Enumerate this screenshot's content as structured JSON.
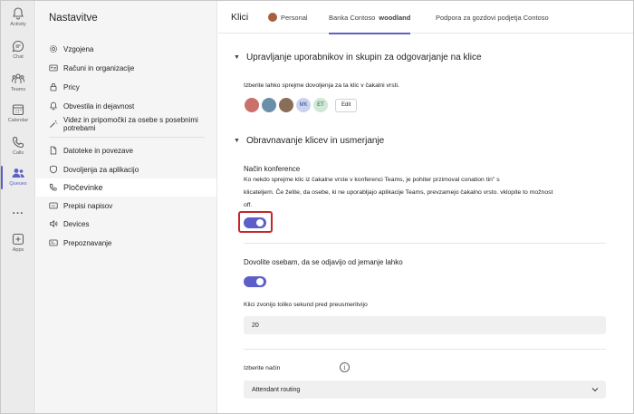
{
  "rail": [
    {
      "label": "Activity",
      "icon": "bell-icon"
    },
    {
      "label": "Chat",
      "icon": "chat-icon"
    },
    {
      "label": "Teams",
      "icon": "teams-icon"
    },
    {
      "label": "Calendar",
      "icon": "calendar-icon"
    },
    {
      "label": "Calls",
      "icon": "phone-icon"
    },
    {
      "label": "Queues",
      "icon": "queues-icon"
    },
    {
      "label": "...",
      "icon": "more-icon"
    },
    {
      "label": "Apps",
      "icon": "apps-icon"
    }
  ],
  "sidebar": {
    "title": "Nastavitve",
    "items": [
      {
        "label": "Vzgojena",
        "icon": "gear-icon"
      },
      {
        "label": "Računi in organizacije",
        "icon": "id-card-icon"
      },
      {
        "label": "Pricy",
        "icon": "lock-icon"
      },
      {
        "label": "Obvestila in dejavnost",
        "icon": "bell-icon"
      },
      {
        "label": "Videz in pripomočki za osebe s posebnimi potrebami",
        "icon": "wand-icon"
      },
      {
        "label": "Datoteke in povezave",
        "icon": "file-icon"
      },
      {
        "label": "Dovoljenja za aplikacijo",
        "icon": "shield-icon"
      },
      {
        "label": "Pločevinke",
        "icon": "phone-icon"
      },
      {
        "label": "Prepisi napisov",
        "icon": "cc-icon"
      },
      {
        "label": "Devices",
        "icon": "speaker-icon"
      },
      {
        "label": "Prepoznavanje",
        "icon": "recognition-icon"
      }
    ]
  },
  "tabs": {
    "title": "Klici",
    "personal": "Personal",
    "bank": "Banka Contoso",
    "bank_bold": "woodland",
    "support": "Podpora za gozdovi podjetja Contoso"
  },
  "section1": {
    "heading": "Upravljanje uporabnikov in skupin za odgovarjanje na klice",
    "description": "Izberite lahko sprejme dovoljenja za ta klic v čakalni vrsti.",
    "avatars": [
      "",
      "",
      "",
      "MK",
      "ET"
    ],
    "edit_label": "Edit"
  },
  "section2": {
    "heading": "Obravnavanje klicev in usmerjanje",
    "conference_label": "Način konference",
    "conference_desc_1": "Ko nekdo sprejme klic iz čakalne vrste v konferenci Teams, je pohiter przimoval conation tin\" s",
    "conference_desc_2": "klicateljem. Če želite, da osebe, ki ne uporabljajo aplikacije Teams, prevzamejo čakalno vrsto. vklopite to možnost",
    "conference_desc_3": "off.",
    "conference_on": true,
    "optout_label": "Dovolite osebam, da se odjavijo od jemanje lahko",
    "optout_on": true,
    "ring_label": "Klici zvonijo toliko sekund pred preusmeritvijo",
    "ring_value": "20",
    "method_label": "Izberite način",
    "method_value": "Attendant routing"
  },
  "colors": {
    "accent": "#5b5fc7",
    "highlight": "#c4262e"
  }
}
